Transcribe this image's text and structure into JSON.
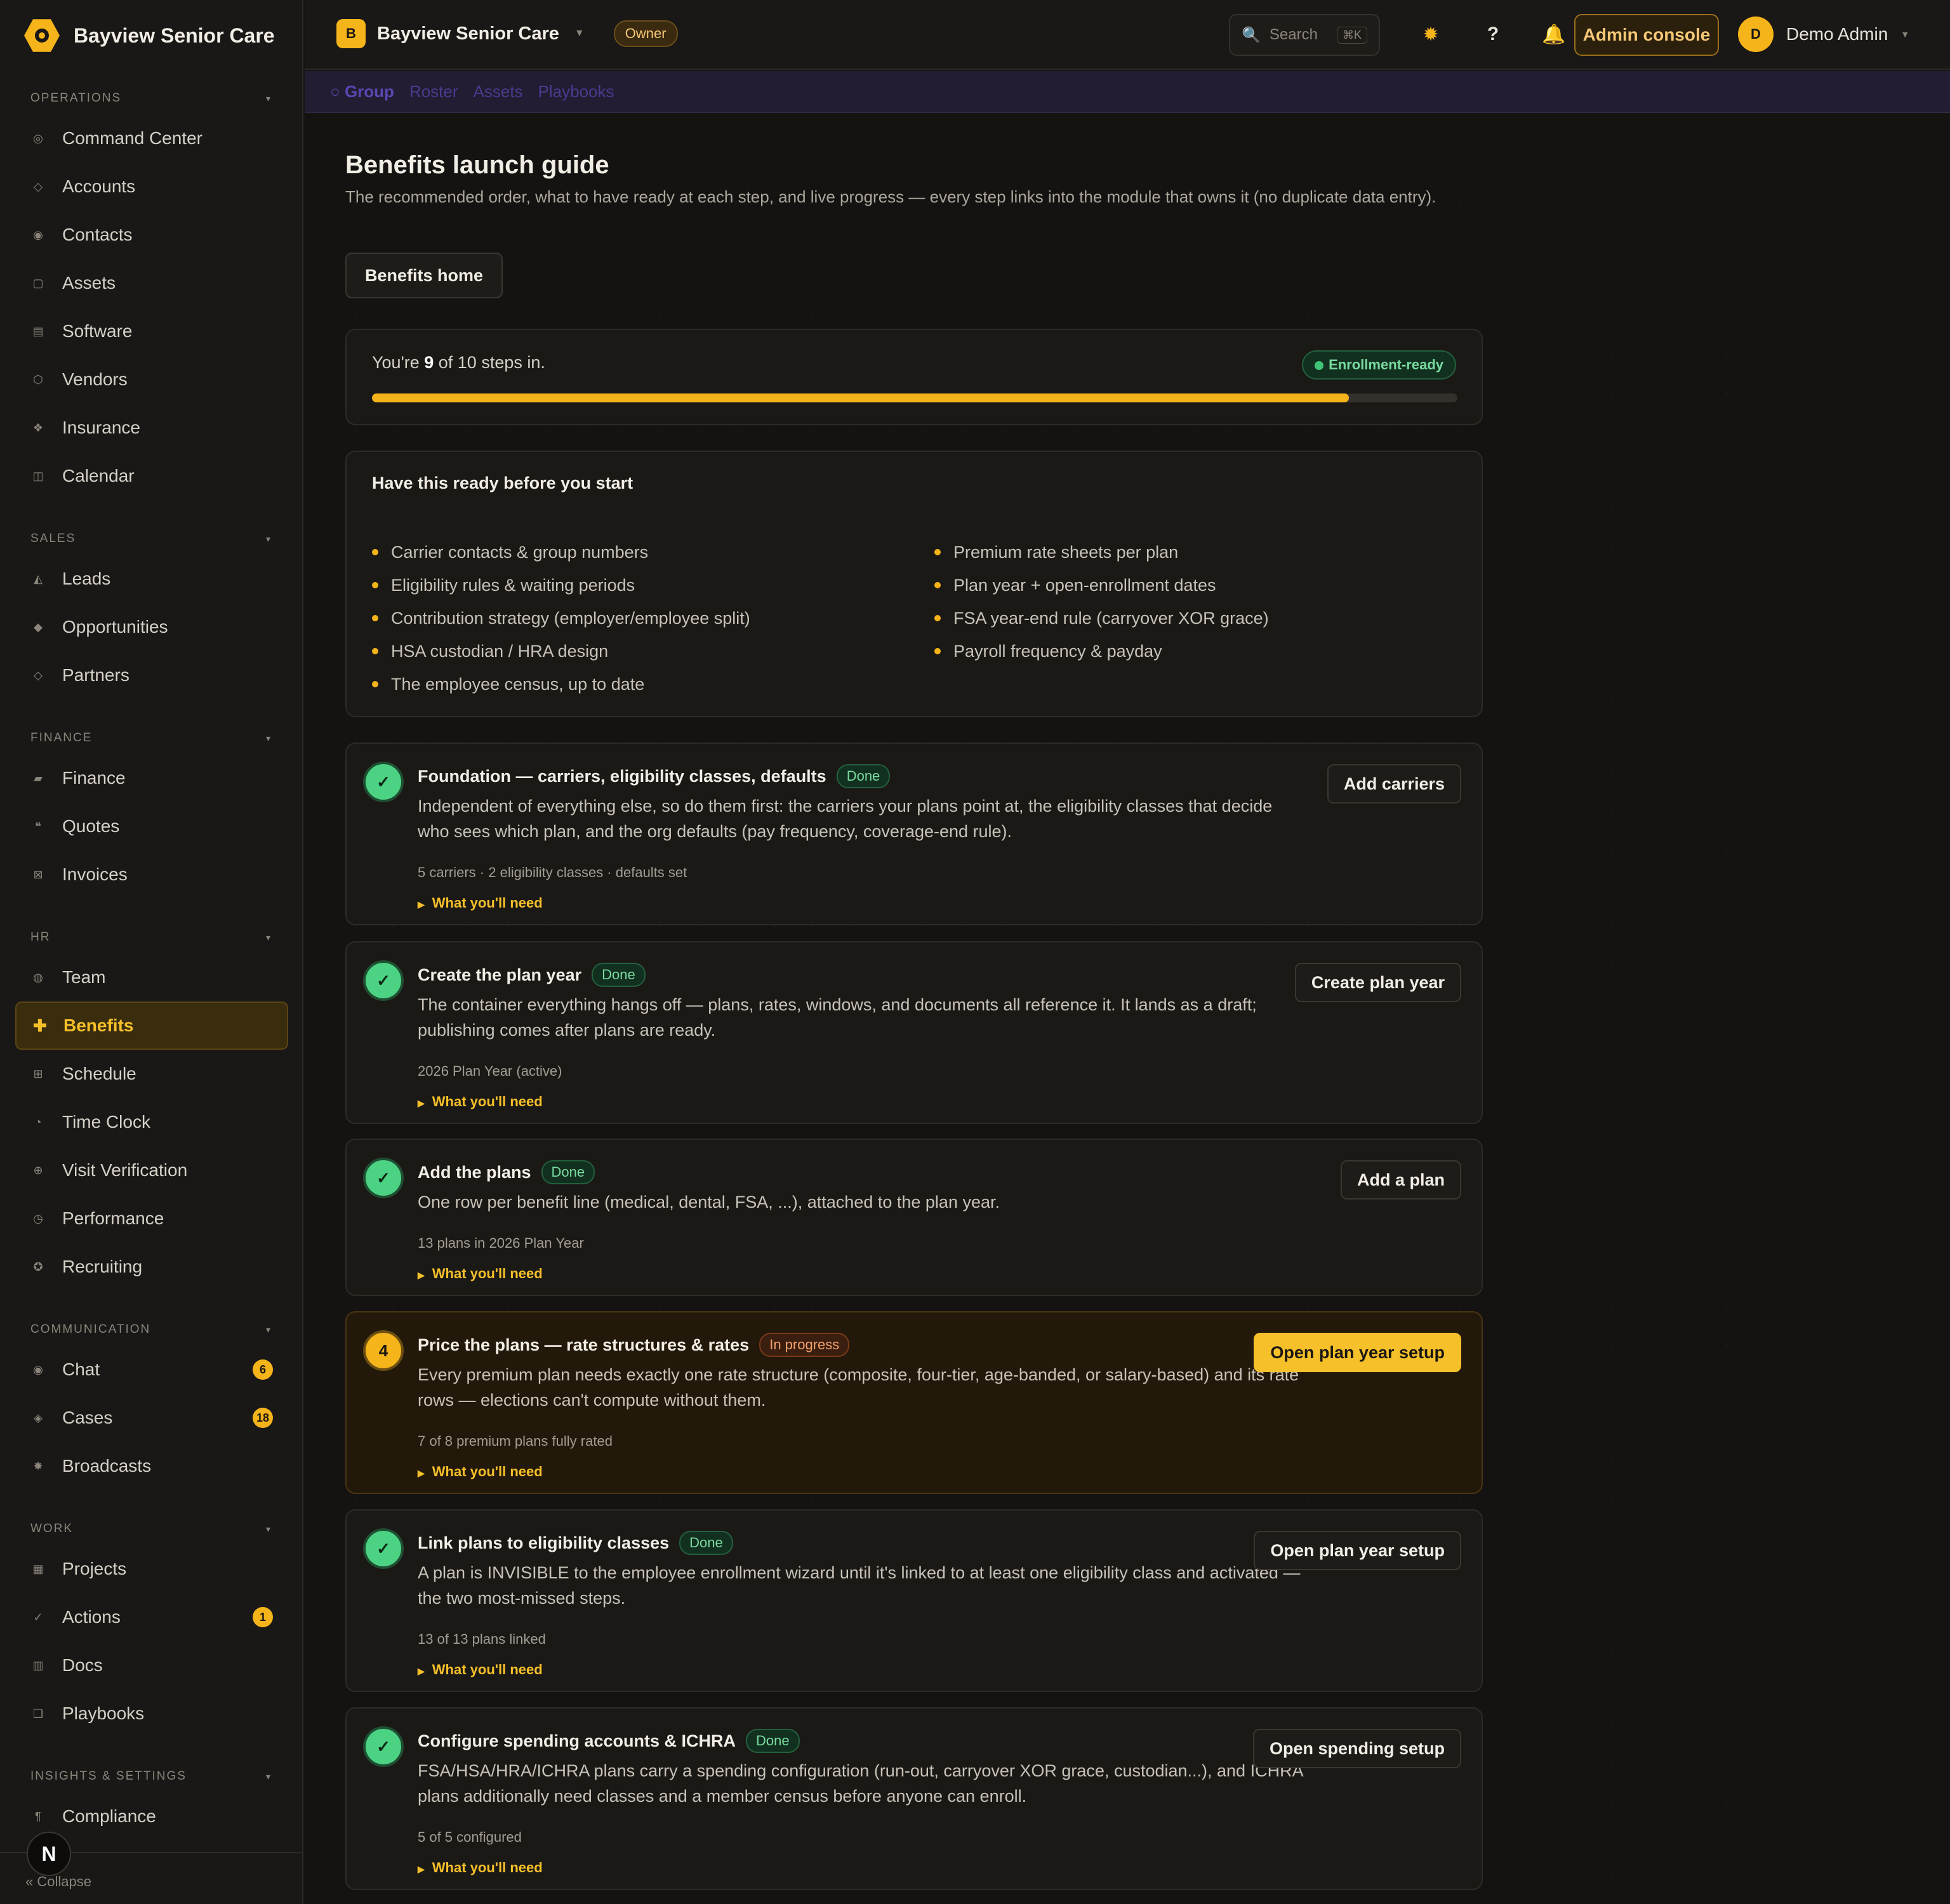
{
  "app": {
    "brand": "Bayview Senior Care",
    "org_initial": "B",
    "org_name": "Bayview Senior Care",
    "owner_badge": "Owner"
  },
  "topbar": {
    "search_placeholder": "Search",
    "search_shortcut": "⌘K",
    "admin_label": "Admin console",
    "user_initial": "D",
    "user_name": "Demo Admin"
  },
  "subtabs": [
    "Group",
    "Roster",
    "Assets",
    "Playbooks"
  ],
  "sidebar": {
    "sections": [
      {
        "title": "OPERATIONS",
        "items": [
          {
            "label": "Command Center",
            "icon": "◎"
          },
          {
            "label": "Accounts",
            "icon": "◇"
          },
          {
            "label": "Contacts",
            "icon": "◉"
          },
          {
            "label": "Assets",
            "icon": "▢"
          },
          {
            "label": "Software",
            "icon": "▤"
          },
          {
            "label": "Vendors",
            "icon": "⬡"
          },
          {
            "label": "Insurance",
            "icon": "❖"
          },
          {
            "label": "Calendar",
            "icon": "◫"
          }
        ]
      },
      {
        "title": "SALES",
        "items": [
          {
            "label": "Leads",
            "icon": "◭"
          },
          {
            "label": "Opportunities",
            "icon": "◆"
          },
          {
            "label": "Partners",
            "icon": "◇"
          }
        ]
      },
      {
        "title": "FINANCE",
        "items": [
          {
            "label": "Finance",
            "icon": "▰"
          },
          {
            "label": "Quotes",
            "icon": "❝"
          },
          {
            "label": "Invoices",
            "icon": "⊠"
          }
        ]
      },
      {
        "title": "HR",
        "items": [
          {
            "label": "Team",
            "icon": "◍"
          },
          {
            "label": "Benefits",
            "icon": "✚",
            "active": true
          },
          {
            "label": "Schedule",
            "icon": "⊞"
          },
          {
            "label": "Time Clock",
            "icon": "◔"
          },
          {
            "label": "Visit Verification",
            "icon": "⊕"
          },
          {
            "label": "Performance",
            "icon": "◷"
          },
          {
            "label": "Recruiting",
            "icon": "✪"
          }
        ]
      },
      {
        "title": "COMMUNICATION",
        "items": [
          {
            "label": "Chat",
            "icon": "◉",
            "badge": "6"
          },
          {
            "label": "Cases",
            "icon": "◈",
            "badge": "18"
          },
          {
            "label": "Broadcasts",
            "icon": "✸"
          }
        ]
      },
      {
        "title": "WORK",
        "items": [
          {
            "label": "Projects",
            "icon": "▦"
          },
          {
            "label": "Actions",
            "icon": "✓",
            "badge": "1"
          },
          {
            "label": "Docs",
            "icon": "▥"
          },
          {
            "label": "Playbooks",
            "icon": "❏"
          }
        ]
      },
      {
        "title": "INSIGHTS & SETTINGS",
        "items": [
          {
            "label": "Compliance",
            "icon": "¶"
          }
        ]
      }
    ],
    "collapse_label": "« Collapse",
    "floating_initial": "N"
  },
  "page": {
    "title": "Benefits launch guide",
    "subtitle": "The recommended order, what to have ready at each step, and live progress — every step links into the module that owns it (no duplicate data entry).",
    "home_button": "Benefits home",
    "progress": {
      "prefix": "You're ",
      "done": "9",
      "suffix": " of 10 steps in.",
      "fraction": 0.9,
      "status": "Enrollment-ready"
    },
    "ready": {
      "title": "Have this ready before you start",
      "left": [
        "Carrier contacts & group numbers",
        "Eligibility rules & waiting periods",
        "Contribution strategy (employer/employee split)",
        "HSA custodian / HRA design",
        "The employee census, up to date"
      ],
      "right": [
        "Premium rate sheets per plan",
        "Plan year + open-enrollment dates",
        "FSA year-end rule (carryover XOR grace)",
        "Payroll frequency & payday"
      ]
    },
    "need_label": "What you'll need",
    "steps": [
      {
        "mark": "✓",
        "title": "Foundation — carriers, eligibility classes, defaults",
        "status": "Done",
        "desc": "Independent of everything else, so do them first: the carriers your plans point at, the eligibility classes that decide who sees which plan, and the org defaults (pay frequency, coverage-end rule).",
        "meta": "5 carriers · 2 eligibility classes · defaults set",
        "button": "Add carriers"
      },
      {
        "mark": "✓",
        "title": "Create the plan year",
        "status": "Done",
        "desc": "The container everything hangs off — plans, rates, windows, and documents all reference it. It lands as a draft; publishing comes after plans are ready.",
        "meta": "2026 Plan Year (active)",
        "button": "Create plan year"
      },
      {
        "mark": "✓",
        "title": "Add the plans",
        "status": "Done",
        "desc": "One row per benefit line (medical, dental, FSA, ...), attached to the plan year.",
        "meta": "13 plans in 2026 Plan Year",
        "button": "Add a plan"
      },
      {
        "mark": "4",
        "title": "Price the plans — rate structures & rates",
        "status": "In progress",
        "desc": "Every premium plan needs exactly one rate structure (composite, four-tier, age-banded, or salary-based) and its rate rows — elections can't compute without them.",
        "meta": "7 of 8 premium plans fully rated",
        "button": "Open plan year setup"
      },
      {
        "mark": "✓",
        "title": "Link plans to eligibility classes",
        "status": "Done",
        "desc": "A plan is INVISIBLE to the employee enrollment wizard until it's linked to at least one eligibility class and activated — the two most-missed steps.",
        "meta": "13 of 13 plans linked",
        "button": "Open plan year setup"
      },
      {
        "mark": "✓",
        "title": "Configure spending accounts & ICHRA",
        "status": "Done",
        "desc": "FSA/HSA/HRA/ICHRA plans carry a spending configuration (run-out, carryover XOR grace, custodian...), and ICHRA plans additionally need classes and a member census before anyone can enroll.",
        "meta": "5 of 5 configured",
        "button": "Open spending setup"
      }
    ]
  }
}
